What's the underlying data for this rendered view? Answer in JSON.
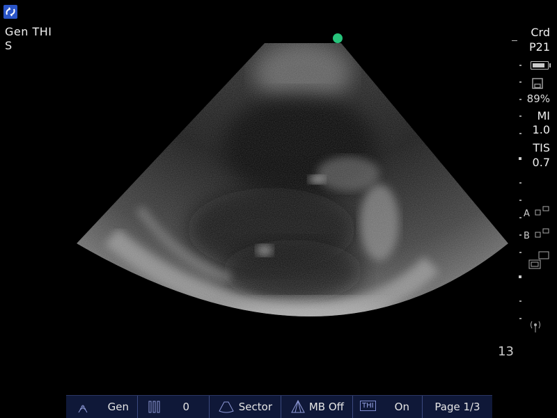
{
  "header": {
    "mode_line1": "Gen  THI",
    "mode_line2": "S"
  },
  "status": {
    "exam": "Crd",
    "preset": "P21",
    "storage": "89%",
    "mi_label": "MI",
    "mi_value": "1.0",
    "tis_label": "TIS",
    "tis_value": "0.7",
    "depth": "13",
    "caliper_a": "A",
    "caliper_b": "B",
    "battery_level": 0.85
  },
  "bottom_bar": {
    "gain_label": "Gen",
    "zoom_label": "0",
    "sector_label": "Sector",
    "mb_label": "MB Off",
    "thi_icon_text": "THI",
    "thi_label": "On",
    "page_label": "Page 1/3"
  },
  "icons": [
    "app-logo-icon",
    "orientation-marker",
    "battery-icon",
    "storage-icon",
    "caliper-a-icon",
    "caliper-b-icon",
    "dual-screen-icon",
    "wireless-icon",
    "gain-icon",
    "zoom-bars-icon",
    "sector-icon",
    "multibeam-icon",
    "thi-icon"
  ],
  "colors": {
    "orientation_dot": "#27c37b",
    "bar_bg": "#0f1838",
    "logo": "#2a55c8"
  }
}
